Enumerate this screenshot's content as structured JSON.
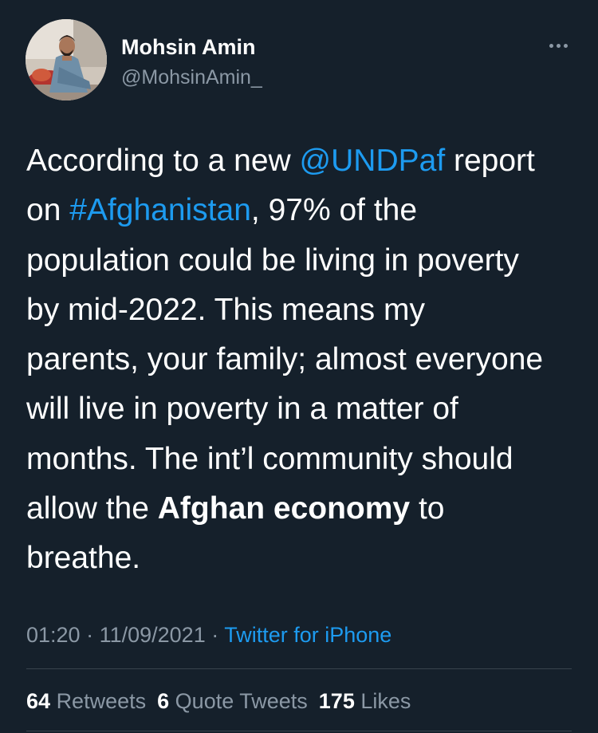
{
  "author": {
    "display_name": "Mohsin Amin",
    "handle": "@MohsinAmin_"
  },
  "tweet": {
    "lines": [
      [
        {
          "text": "According to a new "
        },
        {
          "text": "@UNDPaf",
          "style": "link"
        },
        {
          "text": " report"
        }
      ],
      [
        {
          "text": "on "
        },
        {
          "text": "#Afghanistan",
          "style": "link"
        },
        {
          "text": ", 97% of the"
        }
      ],
      [
        {
          "text": "population could be living in poverty"
        }
      ],
      [
        {
          "text": "by mid-2022. This means my"
        }
      ],
      [
        {
          "text": "parents, your family; almost everyone"
        }
      ],
      [
        {
          "text": "will live in poverty in a matter of"
        }
      ],
      [
        {
          "text": "months. The int’l community should"
        }
      ],
      [
        {
          "text": "allow the "
        },
        {
          "text": "Afghan economy",
          "style": "bold"
        },
        {
          "text": " to"
        }
      ],
      [
        {
          "text": "breathe."
        }
      ]
    ]
  },
  "meta": {
    "time": "01:20",
    "separator": " · ",
    "date": "11/09/2021",
    "source": "Twitter for iPhone"
  },
  "stats": {
    "retweets_count": "64",
    "retweets_label": "Retweets",
    "quotes_count": "6",
    "quotes_label": "Quote Tweets",
    "likes_count": "175",
    "likes_label": "Likes"
  },
  "colors": {
    "background": "#15202b",
    "link": "#1d9bf0",
    "secondary_text": "#8b98a5",
    "divider": "#38444d"
  },
  "icons": {
    "more": "more-horizontal-icon"
  }
}
